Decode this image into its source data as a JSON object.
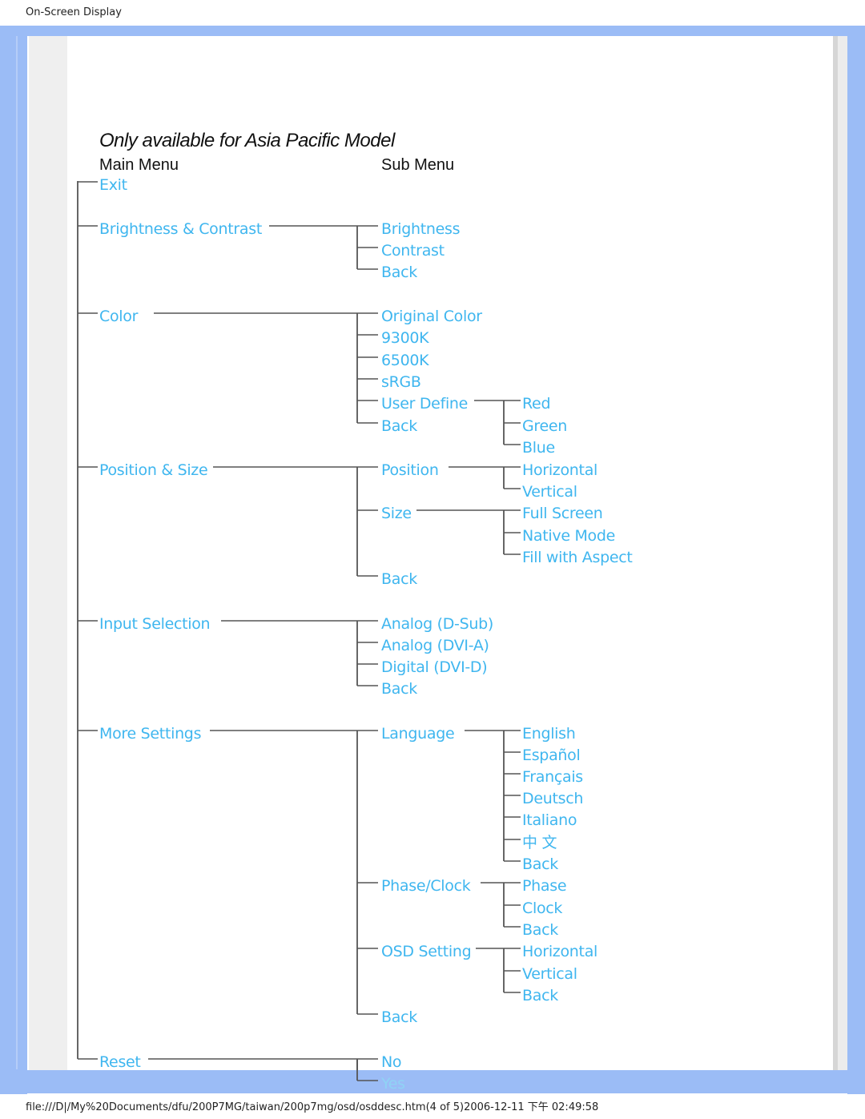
{
  "header": {
    "title": "On-Screen Display"
  },
  "footer": {
    "path": "file:///D|/My%20Documents/dfu/200P7MG/taiwan/200p7mg/osd/osddesc.htm(4 of 5)2006-12-11 下午 02:49:58"
  },
  "diagram": {
    "title": "Only available for Asia Pacific Model",
    "main_menu_heading": "Main Menu",
    "sub_menu_heading": "Sub Menu",
    "text_color": "#3fb6ef",
    "line_color": "#555555",
    "main": [
      {
        "label": "Exit",
        "sub": []
      },
      {
        "label": "Brightness & Contrast",
        "sub": [
          {
            "label": "Brightness"
          },
          {
            "label": "Contrast"
          },
          {
            "label": "Back"
          }
        ]
      },
      {
        "label": "Color",
        "sub": [
          {
            "label": "Original Color"
          },
          {
            "label": "9300K"
          },
          {
            "label": "6500K"
          },
          {
            "label": "sRGB"
          },
          {
            "label": "User Define",
            "sub": [
              {
                "label": "Red"
              },
              {
                "label": "Green"
              },
              {
                "label": "Blue"
              }
            ]
          },
          {
            "label": "Back"
          }
        ]
      },
      {
        "label": "Position & Size",
        "sub": [
          {
            "label": "Position",
            "sub": [
              {
                "label": "Horizontal"
              },
              {
                "label": "Vertical"
              }
            ]
          },
          {
            "label": "Size",
            "sub": [
              {
                "label": "Full Screen"
              },
              {
                "label": "Native Mode"
              },
              {
                "label": "Fill with Aspect"
              }
            ]
          },
          {
            "label": "Back"
          }
        ]
      },
      {
        "label": "Input Selection",
        "sub": [
          {
            "label": "Analog (D-Sub)"
          },
          {
            "label": "Analog (DVI-A)"
          },
          {
            "label": "Digital (DVI-D)"
          },
          {
            "label": "Back"
          }
        ]
      },
      {
        "label": "More Settings",
        "sub": [
          {
            "label": "Language",
            "sub": [
              {
                "label": "English"
              },
              {
                "label": "Español"
              },
              {
                "label": "Français"
              },
              {
                "label": "Deutsch"
              },
              {
                "label": "Italiano"
              },
              {
                "label": "中 文"
              },
              {
                "label": "Back"
              }
            ]
          },
          {
            "label": "Phase/Clock",
            "sub": [
              {
                "label": "Phase"
              },
              {
                "label": "Clock"
              },
              {
                "label": "Back"
              }
            ]
          },
          {
            "label": "OSD Setting",
            "sub": [
              {
                "label": "Horizontal"
              },
              {
                "label": "Vertical"
              },
              {
                "label": "Back"
              }
            ]
          },
          {
            "label": "Back"
          }
        ]
      },
      {
        "label": "Reset",
        "sub": [
          {
            "label": "No"
          },
          {
            "label": "Yes"
          }
        ]
      }
    ]
  }
}
